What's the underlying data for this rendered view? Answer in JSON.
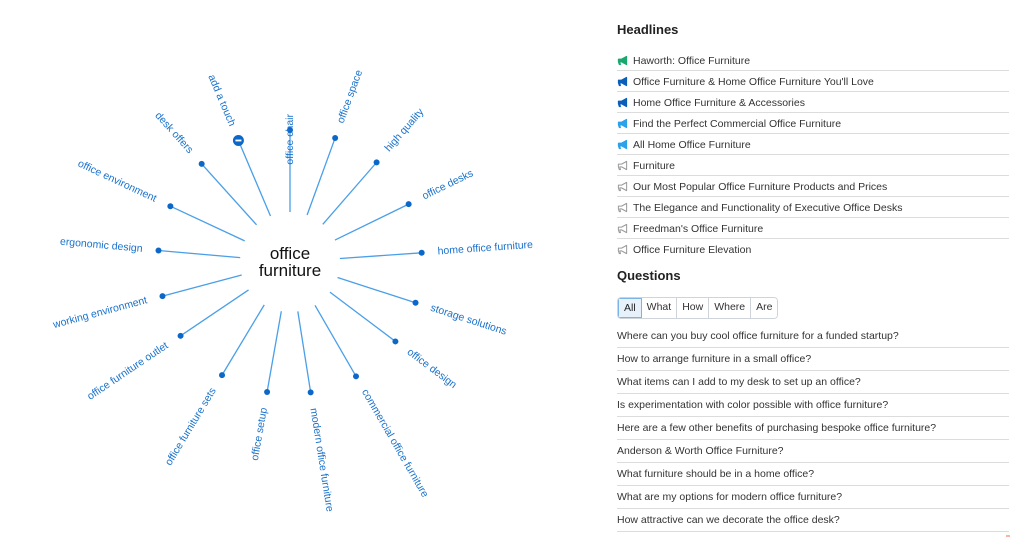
{
  "wheel": {
    "center": [
      "office",
      "furniture"
    ],
    "collapse_icon": "minus-circle-icon",
    "nodes": [
      {
        "label": "office chair",
        "angle": -90
      },
      {
        "label": "office space",
        "angle": -70
      },
      {
        "label": "high quality",
        "angle": -49
      },
      {
        "label": "office desks",
        "angle": -26
      },
      {
        "label": "home office furniture",
        "angle": -4
      },
      {
        "label": "storage solutions",
        "angle": 18
      },
      {
        "label": "office design",
        "angle": 37
      },
      {
        "label": "commercial office furniture",
        "angle": 60
      },
      {
        "label": "modern office furniture",
        "angle": 81
      },
      {
        "label": "office setup",
        "angle": 100
      },
      {
        "label": "office furniture sets",
        "angle": 121
      },
      {
        "label": "office furniture outlet",
        "angle": 146
      },
      {
        "label": "working environment",
        "angle": 165
      },
      {
        "label": "ergonomic design",
        "angle": 185
      },
      {
        "label": "office environment",
        "angle": 205
      },
      {
        "label": "desk offers",
        "angle": 228
      },
      {
        "label": "add a touch",
        "angle": 247,
        "collapsed": true
      }
    ]
  },
  "headlines": {
    "title": "Headlines",
    "items": [
      {
        "text": "Haworth: Office Furniture",
        "icon": "megaphone-icon",
        "color": "#1aa86e",
        "filled": true
      },
      {
        "text": "Office Furniture & Home Office Furniture You'll Love",
        "icon": "megaphone-icon",
        "color": "#0b5fb8",
        "filled": true
      },
      {
        "text": "Home Office Furniture & Accessories",
        "icon": "megaphone-icon",
        "color": "#0b5fb8",
        "filled": true
      },
      {
        "text": "Find the Perfect Commercial Office Furniture",
        "icon": "megaphone-icon",
        "color": "#2ba2ea",
        "filled": true
      },
      {
        "text": "All Home Office Furniture",
        "icon": "megaphone-icon",
        "color": "#2ba2ea",
        "filled": true
      },
      {
        "text": "Furniture",
        "icon": "megaphone-outline-icon",
        "color": "#9a9a9a",
        "filled": false
      },
      {
        "text": "Our Most Popular Office Furniture Products and Prices",
        "icon": "megaphone-outline-icon",
        "color": "#9a9a9a",
        "filled": false
      },
      {
        "text": "The Elegance and Functionality of Executive Office Desks",
        "icon": "megaphone-outline-icon",
        "color": "#9a9a9a",
        "filled": false
      },
      {
        "text": "Freedman's Office Furniture",
        "icon": "megaphone-outline-icon",
        "color": "#9a9a9a",
        "filled": false
      },
      {
        "text": "Office Furniture Elevation",
        "icon": "megaphone-outline-icon",
        "color": "#9a9a9a",
        "filled": false
      }
    ]
  },
  "questions": {
    "title": "Questions",
    "filters": [
      "All",
      "What",
      "How",
      "Where",
      "Are"
    ],
    "active_filter": "All",
    "items": [
      "Where can you buy cool office furniture for a funded startup?",
      "How to arrange furniture in a small office?",
      "What items can I add to my desk to set up an office?",
      "Is experimentation with color possible with office furniture?",
      "Here are a few other benefits of purchasing bespoke office furniture?",
      "Anderson & Worth Office Furniture?",
      "What furniture should be in a home office?",
      "What are my options for modern office furniture?",
      "How attractive can we decorate the office desk?"
    ]
  }
}
